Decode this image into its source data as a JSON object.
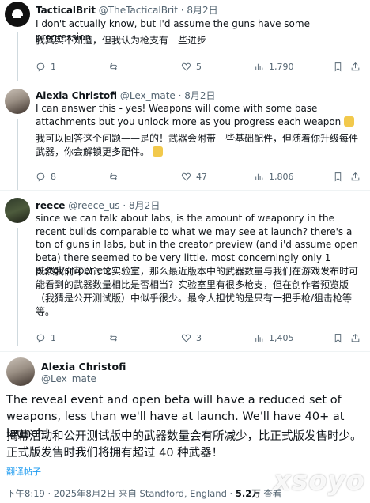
{
  "tweets": [
    {
      "name": "TacticalBrit",
      "handle": "@TheTacticalBrit",
      "date": "8月2日",
      "text": "I don't actually know, but I'd assume the guns have some progression",
      "translation": "我其实不知道，但我认为枪支有一些进步",
      "replies": "1",
      "retweets": "",
      "likes": "5",
      "views": "1,790"
    },
    {
      "name": "Alexia Christofi",
      "handle": "@Lex_mate",
      "date": "8月2日",
      "text": "I can answer this - yes! Weapons will come with some base attachments but you unlock more as you progress each weapon",
      "translation": "我可以回答这个问题——是的！武器会附带一些基础配件，但随着你升级每件武器，你会解锁更多配件。",
      "replies": "8",
      "retweets": "",
      "likes": "47",
      "views": "1,806"
    },
    {
      "name": "reece",
      "handle": "@reece_us",
      "date": "8月2日",
      "text": "since we can talk about labs, is the amount of weaponry in the recent builds comparable to what we may see at launch? there's a ton of guns in labs, but in the creator preview (and i'd assume open beta) there seemed to be very little. most concerningly only 1 pistol/sniper etc",
      "translation": "既然我们可以讨论实验室，那么最近版本中的武器数量与我们在游戏发布时可能看到的武器数量相比是否相当？实验室里有很多枪支，但在创作者预览版（我猜是公开测试版）中似乎很少。最令人担忧的是只有一把手枪/狙击枪等等。",
      "replies": "1",
      "retweets": "",
      "likes": "3",
      "views": "1,405"
    }
  ],
  "main_tweet": {
    "name": "Alexia Christofi",
    "handle": "@Lex_mate",
    "text": "The reveal event and open beta will have a reduced set of weapons, less than we'll have at launch. We'll have 40+ at launch!",
    "translation": "揭幕活动和公开测试版中的武器数量会有所减少，比正式版发售时少。正式版发售时我们将拥有超过 40 种武器！",
    "translate_link": "翻译帖子",
    "time": "下午8:19 · 2025年8月2日",
    "location": "来自 Standford, England",
    "views_count": "5.2万",
    "views_label": "查看"
  },
  "watermark": "xsoyo",
  "colors": {
    "link": "#1d9bf0",
    "secondary": "#536471",
    "primary": "#0f1419",
    "emoji": "#f2c94c"
  }
}
